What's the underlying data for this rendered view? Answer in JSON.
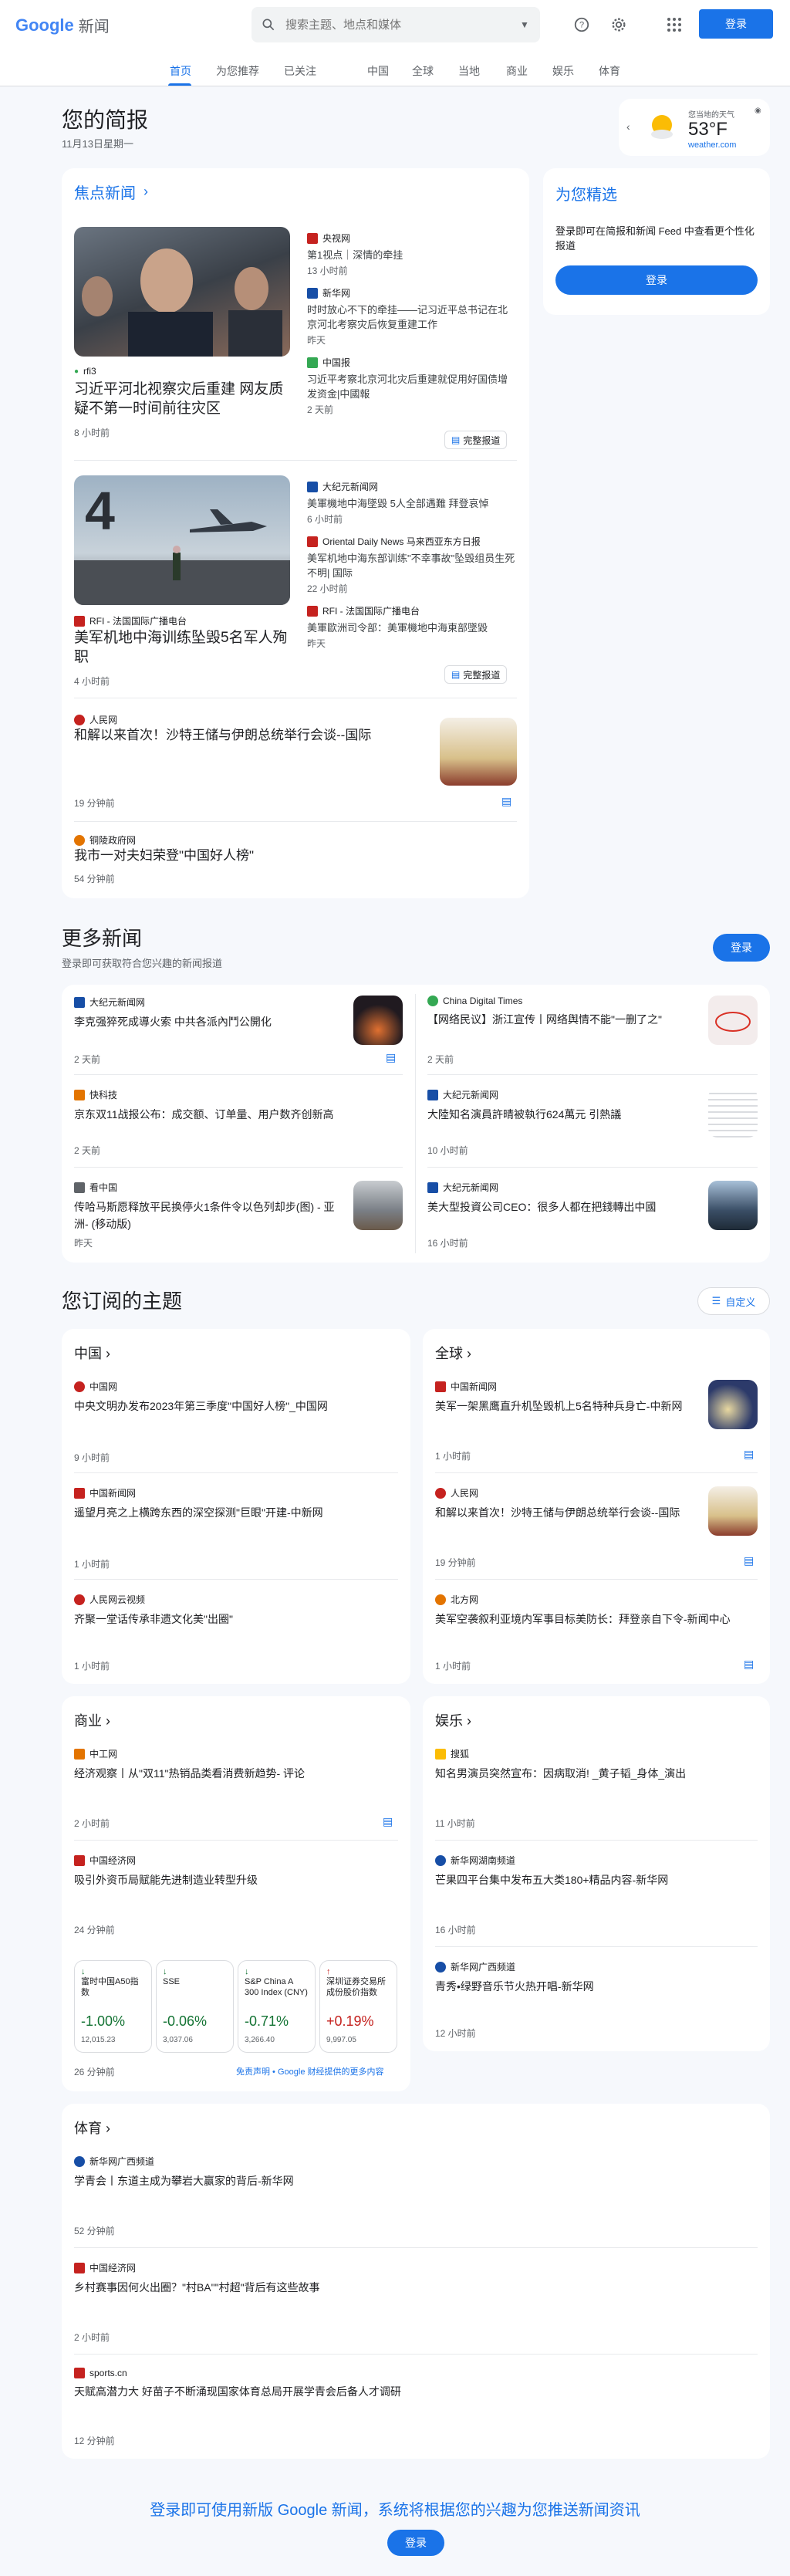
{
  "header": {
    "logo_google": "Google",
    "logo_news": "新闻",
    "search_placeholder": "搜索主题、地点和媒体",
    "signin": "登录"
  },
  "nav": [
    "首页",
    "为您推荐",
    "已关注",
    "中国",
    "全球",
    "当地",
    "商业",
    "娱乐",
    "体育"
  ],
  "briefing": {
    "title": "您的简报",
    "date": "11月13日星期一"
  },
  "weather": {
    "label": "您当地的天气",
    "temp": "53°F",
    "source": "weather.com"
  },
  "top_stories": {
    "title": "焦点新闻",
    "full_coverage": "完整报道",
    "cluster1": {
      "main_source": "rfi3",
      "main_headline": "习近平河北视察灾后重建 网友质疑不第一时间前往灾区",
      "main_time": "8 小时前",
      "side": [
        {
          "source": "央视网",
          "headline": "第1视点｜深情的牵挂",
          "time": "13 小时前"
        },
        {
          "source": "新华网",
          "headline": "时时放心不下的牵挂——记习近平总书记在北京河北考察灾后恢复重建工作",
          "time": "昨天"
        },
        {
          "source": "中国报",
          "headline": "习近平考察北京河北灾后重建就促用好国债增发资金|中國報",
          "time": "2 天前"
        }
      ]
    },
    "cluster2": {
      "main_source": "RFI - 法国国际广播电台",
      "main_headline": "美军机地中海训练坠毁5名军人殉职",
      "main_time": "4 小时前",
      "side": [
        {
          "source": "大纪元新闻网",
          "headline": "美軍機地中海墜毀 5人全部遇難 拜登哀悼",
          "time": "6 小时前"
        },
        {
          "source": "Oriental Daily News 马来西亚东方日报",
          "headline": "美军机地中海东部训练\"不幸事故\"坠毁组员生死不明| 国际",
          "time": "22 小时前"
        },
        {
          "source": "RFI - 法国国际广播电台",
          "headline": "美軍歐洲司令部：美軍機地中海東部墜毀",
          "time": "昨天"
        }
      ]
    },
    "story3": {
      "source": "人民网",
      "headline": "和解以来首次！沙特王储与伊朗总统举行会谈--国际",
      "time": "19 分钟前"
    },
    "story4": {
      "source": "铜陵政府网",
      "headline": "我市一对夫妇荣登\"中国好人榜\"",
      "time": "54 分钟前"
    }
  },
  "picks": {
    "title": "为您精选",
    "desc": "登录即可在简报和新闻 Feed 中查看更个性化报道",
    "button": "登录"
  },
  "more_news": {
    "title": "更多新闻",
    "subtitle": "登录即可获取符合您兴趣的新闻报道",
    "button": "登录",
    "items": [
      {
        "source": "大纪元新闻网",
        "headline": "李克强猝死成導火索 中共各派內鬥公開化",
        "time": "2 天前"
      },
      {
        "source": "China Digital Times",
        "headline": "【网络民议】浙江宣传丨网络舆情不能\"一删了之\"",
        "time": "2 天前"
      },
      {
        "source": "快科技",
        "headline": "京东双11战报公布：成交额、订单量、用户数齐创新高",
        "time": "2 天前"
      },
      {
        "source": "大纪元新闻网",
        "headline": "大陸知名演員許晴被執行624萬元 引熱議",
        "time": "10 小时前"
      },
      {
        "source": "看中国",
        "headline": "传哈马斯愿释放平民换停火1条件令以色列却步(图) - 亚洲- (移动版)",
        "time": "昨天"
      },
      {
        "source": "大纪元新闻网",
        "headline": "美大型投資公司CEO：很多人都在把錢轉出中國",
        "time": "16 小时前"
      }
    ]
  },
  "topics": {
    "title": "您订阅的主题",
    "customize": "自定义",
    "china": {
      "title": "中国",
      "items": [
        {
          "source": "中国网",
          "headline": "中央文明办发布2023年第三季度\"中国好人榜\"_中国网",
          "time": "9 小时前"
        },
        {
          "source": "中国新闻网",
          "headline": "遥望月亮之上横跨东西的深空探测\"巨眼\"开建-中新网",
          "time": "1 小时前"
        },
        {
          "source": "人民网云视频",
          "headline": "齐聚一堂话传承非遗文化美\"出圈\"",
          "time": "1 小时前"
        }
      ]
    },
    "world": {
      "title": "全球",
      "items": [
        {
          "source": "中国新闻网",
          "headline": "美军一架黑鹰直升机坠毁机上5名特种兵身亡-中新网",
          "time": "1 小时前"
        },
        {
          "source": "人民网",
          "headline": "和解以来首次！沙特王储与伊朗总统举行会谈--国际",
          "time": "19 分钟前"
        },
        {
          "source": "北方网",
          "headline": "美军空袭叙利亚境内军事目标美防长：拜登亲自下令-新闻中心",
          "time": "1 小时前"
        }
      ]
    },
    "business": {
      "title": "商业",
      "items": [
        {
          "source": "中工网",
          "headline": "经济观察丨从\"双11\"热销品类看消费新趋势- 评论",
          "time": "2 小时前"
        },
        {
          "source": "中国经济网",
          "headline": "吸引外资币局赋能先进制造业转型升级",
          "time": "24 分钟前"
        }
      ],
      "stocks": [
        {
          "name": "富时中国A50指数",
          "change": "-1.00%",
          "price": "12,015.23",
          "dir": "up"
        },
        {
          "name": "SSE",
          "change": "-0.06%",
          "price": "3,037.06",
          "dir": "up"
        },
        {
          "name": "S&P China A 300 Index (CNY)",
          "change": "-0.71%",
          "price": "3,266.40",
          "dir": "up"
        },
        {
          "name": "深圳证券交易所成份股价指数",
          "change": "+0.19%",
          "price": "9,997.05",
          "dir": "down"
        }
      ],
      "stocks_time": "26 分钟前",
      "disclaimer": "免责声明 • Google 财经提供的更多内容"
    },
    "ent": {
      "title": "娱乐",
      "items": [
        {
          "source": "搜狐",
          "headline": "知名男演员突然宣布：因病取消! _黄子韬_身体_演出",
          "time": "11 小时前"
        },
        {
          "source": "新华网湖南频道",
          "headline": "芒果四平台集中发布五大类180+精品内容-新华网",
          "time": "16 小时前"
        },
        {
          "source": "新华网广西频道",
          "headline": "青秀•绿野音乐节火热开唱-新华网",
          "time": "12 小时前"
        }
      ]
    },
    "sports": {
      "title": "体育",
      "items": [
        {
          "source": "新华网广西频道",
          "headline": "学青会丨东道主成为攀岩大赢家的背后-新华网",
          "time": "52 分钟前"
        },
        {
          "source": "中国经济网",
          "headline": "乡村赛事因何火出圈？\"村BA\"\"村超\"背后有这些故事",
          "time": "2 小时前"
        },
        {
          "source": "sports.cn",
          "headline": "天赋高潜力大 好苗子不断涌现国家体育总局开展学青会后备人才调研",
          "time": "12 分钟前"
        }
      ]
    }
  },
  "footer": {
    "text": "登录即可使用新版 Google 新闻，系统将根据您的兴趣为您推送新闻资讯",
    "button": "登录"
  }
}
